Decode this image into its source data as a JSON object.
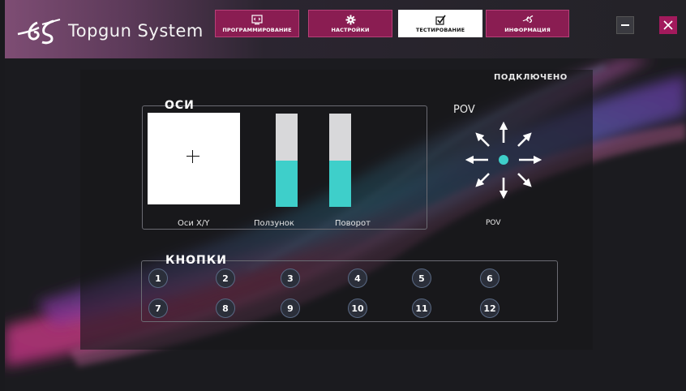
{
  "app": {
    "title": "Topgun System"
  },
  "tabs": [
    {
      "label": "ПРОГРАММИРОВАНИЕ",
      "icon": "code-icon",
      "active": false
    },
    {
      "label": "НАСТРОЙКИ",
      "icon": "gear-icon",
      "active": false
    },
    {
      "label": "ТЕСТИРОВАНИЕ",
      "icon": "checkbox-icon",
      "active": true
    },
    {
      "label": "ИНФОРМАЦИЯ",
      "icon": "logo-icon",
      "active": false
    }
  ],
  "window_controls": {
    "minimize_icon": "minimize-icon",
    "close_icon": "close-icon"
  },
  "status": "ПОДКЛЮЧЕНО",
  "axes": {
    "title": "ОСИ",
    "xy_label": "Оси X/Y",
    "slider_label": "Ползунок",
    "rotation_label": "Поворот",
    "slider_level": 0.5,
    "rotation_level": 0.5
  },
  "pov": {
    "title": "POV",
    "label": "POV"
  },
  "buttons": {
    "title": "КНОПКИ",
    "labels": [
      "1",
      "2",
      "3",
      "4",
      "5",
      "6",
      "7",
      "8",
      "9",
      "10",
      "11",
      "12"
    ]
  },
  "colors": {
    "accent": "#8a1d52",
    "teal": "#3ecfca",
    "close": "#a21a5c"
  }
}
